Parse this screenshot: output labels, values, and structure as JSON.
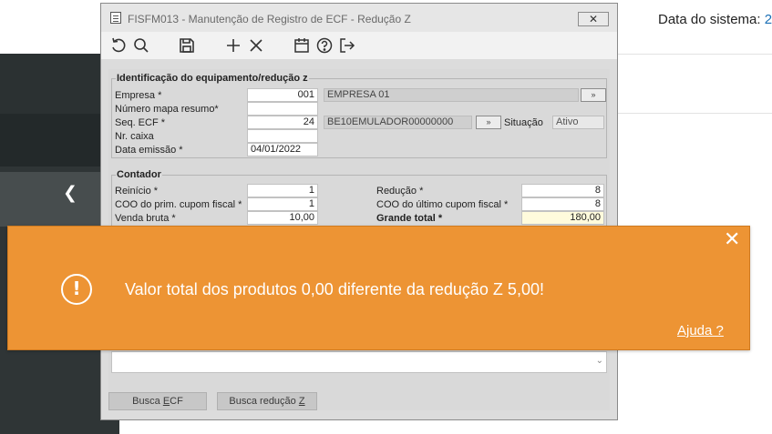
{
  "system": {
    "date_label": "Data do sistema:",
    "date_value": "2"
  },
  "background": {
    "sidebar_toggle_icon": "chevron-left-icon"
  },
  "window": {
    "icon": "document-icon",
    "title": "FISFM013 - Manutenção de Registro de ECF - Redução Z",
    "close_label": "✕"
  },
  "toolbar": {
    "icons": [
      "undo-icon",
      "search-icon",
      "save-icon",
      "add-icon",
      "delete-icon",
      "calendar-icon",
      "help-icon",
      "exit-icon"
    ]
  },
  "identificacao": {
    "title": "Identificação do equipamento/redução z",
    "empresa_label": "Empresa *",
    "empresa_value": "001",
    "empresa_nome": "EMPRESA 01",
    "mapa_label": "Número mapa resumo*",
    "mapa_value": "",
    "seq_label": "Seq. ECF *",
    "seq_value": "24",
    "seq_desc": "BE10EMULADOR00000000",
    "situacao_label": "Situação",
    "situacao_value": "Ativo",
    "caixa_label": "Nr. caixa",
    "caixa_value": "",
    "data_label": "Data emissão *",
    "data_value": "04/01/2022",
    "lookup_label": "»"
  },
  "contador": {
    "title": "Contador",
    "reinicio_label": "Reinício *",
    "reinicio_value": "1",
    "reducao_label": "Redução *",
    "reducao_value": "8",
    "coo_prim_label": "COO do prim. cupom fiscal *",
    "coo_prim_value": "1",
    "coo_ult_label": "COO do último cupom fiscal *",
    "coo_ult_value": "8",
    "venda_label": "Venda bruta *",
    "venda_value": "10,00",
    "grande_label": "Grande total *",
    "grande_value": "180,00"
  },
  "buttons": {
    "busca_ecf_pre": "Busca ",
    "busca_ecf_key": "E",
    "busca_ecf_post": "CF",
    "busca_red_pre": "Busca redução ",
    "busca_red_key": "Z"
  },
  "toast": {
    "close_label": "✕",
    "icon_glyph": "!",
    "message": "Valor total dos produtos 0,00 diferente da redução Z 5,00!",
    "help_link": "Ajuda ?"
  }
}
